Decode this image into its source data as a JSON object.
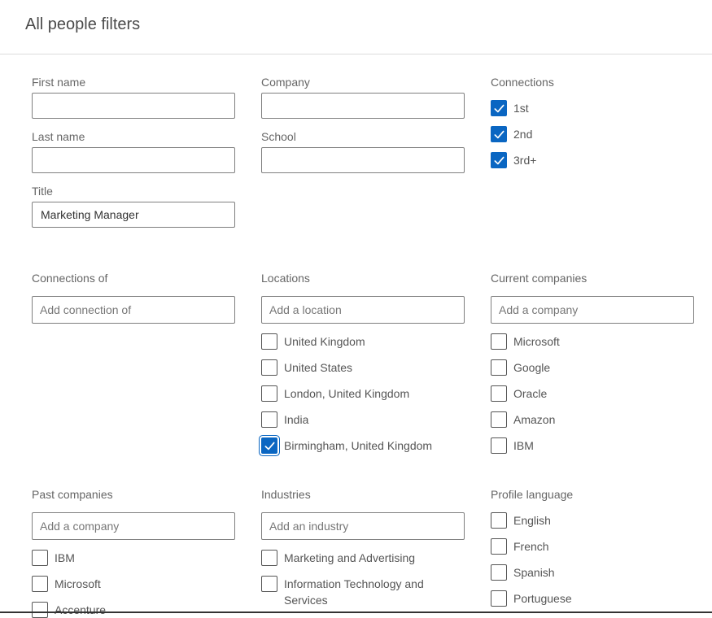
{
  "header": {
    "title": "All people filters"
  },
  "colors": {
    "accent": "#0a66c2"
  },
  "fields": {
    "first_name": {
      "label": "First name",
      "value": ""
    },
    "last_name": {
      "label": "Last name",
      "value": ""
    },
    "title": {
      "label": "Title",
      "value": "Marketing Manager"
    },
    "company": {
      "label": "Company",
      "value": ""
    },
    "school": {
      "label": "School",
      "value": ""
    }
  },
  "connections": {
    "label": "Connections",
    "options": [
      {
        "label": "1st",
        "checked": true
      },
      {
        "label": "2nd",
        "checked": true
      },
      {
        "label": "3rd+",
        "checked": true
      }
    ]
  },
  "connections_of": {
    "label": "Connections of",
    "placeholder": "Add connection of"
  },
  "locations": {
    "label": "Locations",
    "placeholder": "Add a location",
    "options": [
      {
        "label": "United Kingdom",
        "checked": false
      },
      {
        "label": "United States",
        "checked": false
      },
      {
        "label": "London, United Kingdom",
        "checked": false
      },
      {
        "label": "India",
        "checked": false
      },
      {
        "label": "Birmingham, United Kingdom",
        "checked": true
      }
    ]
  },
  "current_companies": {
    "label": "Current companies",
    "placeholder": "Add a company",
    "options": [
      {
        "label": "Microsoft",
        "checked": false
      },
      {
        "label": "Google",
        "checked": false
      },
      {
        "label": "Oracle",
        "checked": false
      },
      {
        "label": "Amazon",
        "checked": false
      },
      {
        "label": "IBM",
        "checked": false
      }
    ]
  },
  "past_companies": {
    "label": "Past companies",
    "placeholder": "Add a company",
    "options": [
      {
        "label": "IBM",
        "checked": false
      },
      {
        "label": "Microsoft",
        "checked": false
      },
      {
        "label": "Accenture",
        "checked": false
      }
    ]
  },
  "industries": {
    "label": "Industries",
    "placeholder": "Add an industry",
    "options": [
      {
        "label": "Marketing and Advertising",
        "checked": false
      },
      {
        "label": "Information Technology and Services",
        "checked": false
      }
    ]
  },
  "profile_language": {
    "label": "Profile language",
    "options": [
      {
        "label": "English",
        "checked": false
      },
      {
        "label": "French",
        "checked": false
      },
      {
        "label": "Spanish",
        "checked": false
      },
      {
        "label": "Portuguese",
        "checked": false
      }
    ]
  }
}
